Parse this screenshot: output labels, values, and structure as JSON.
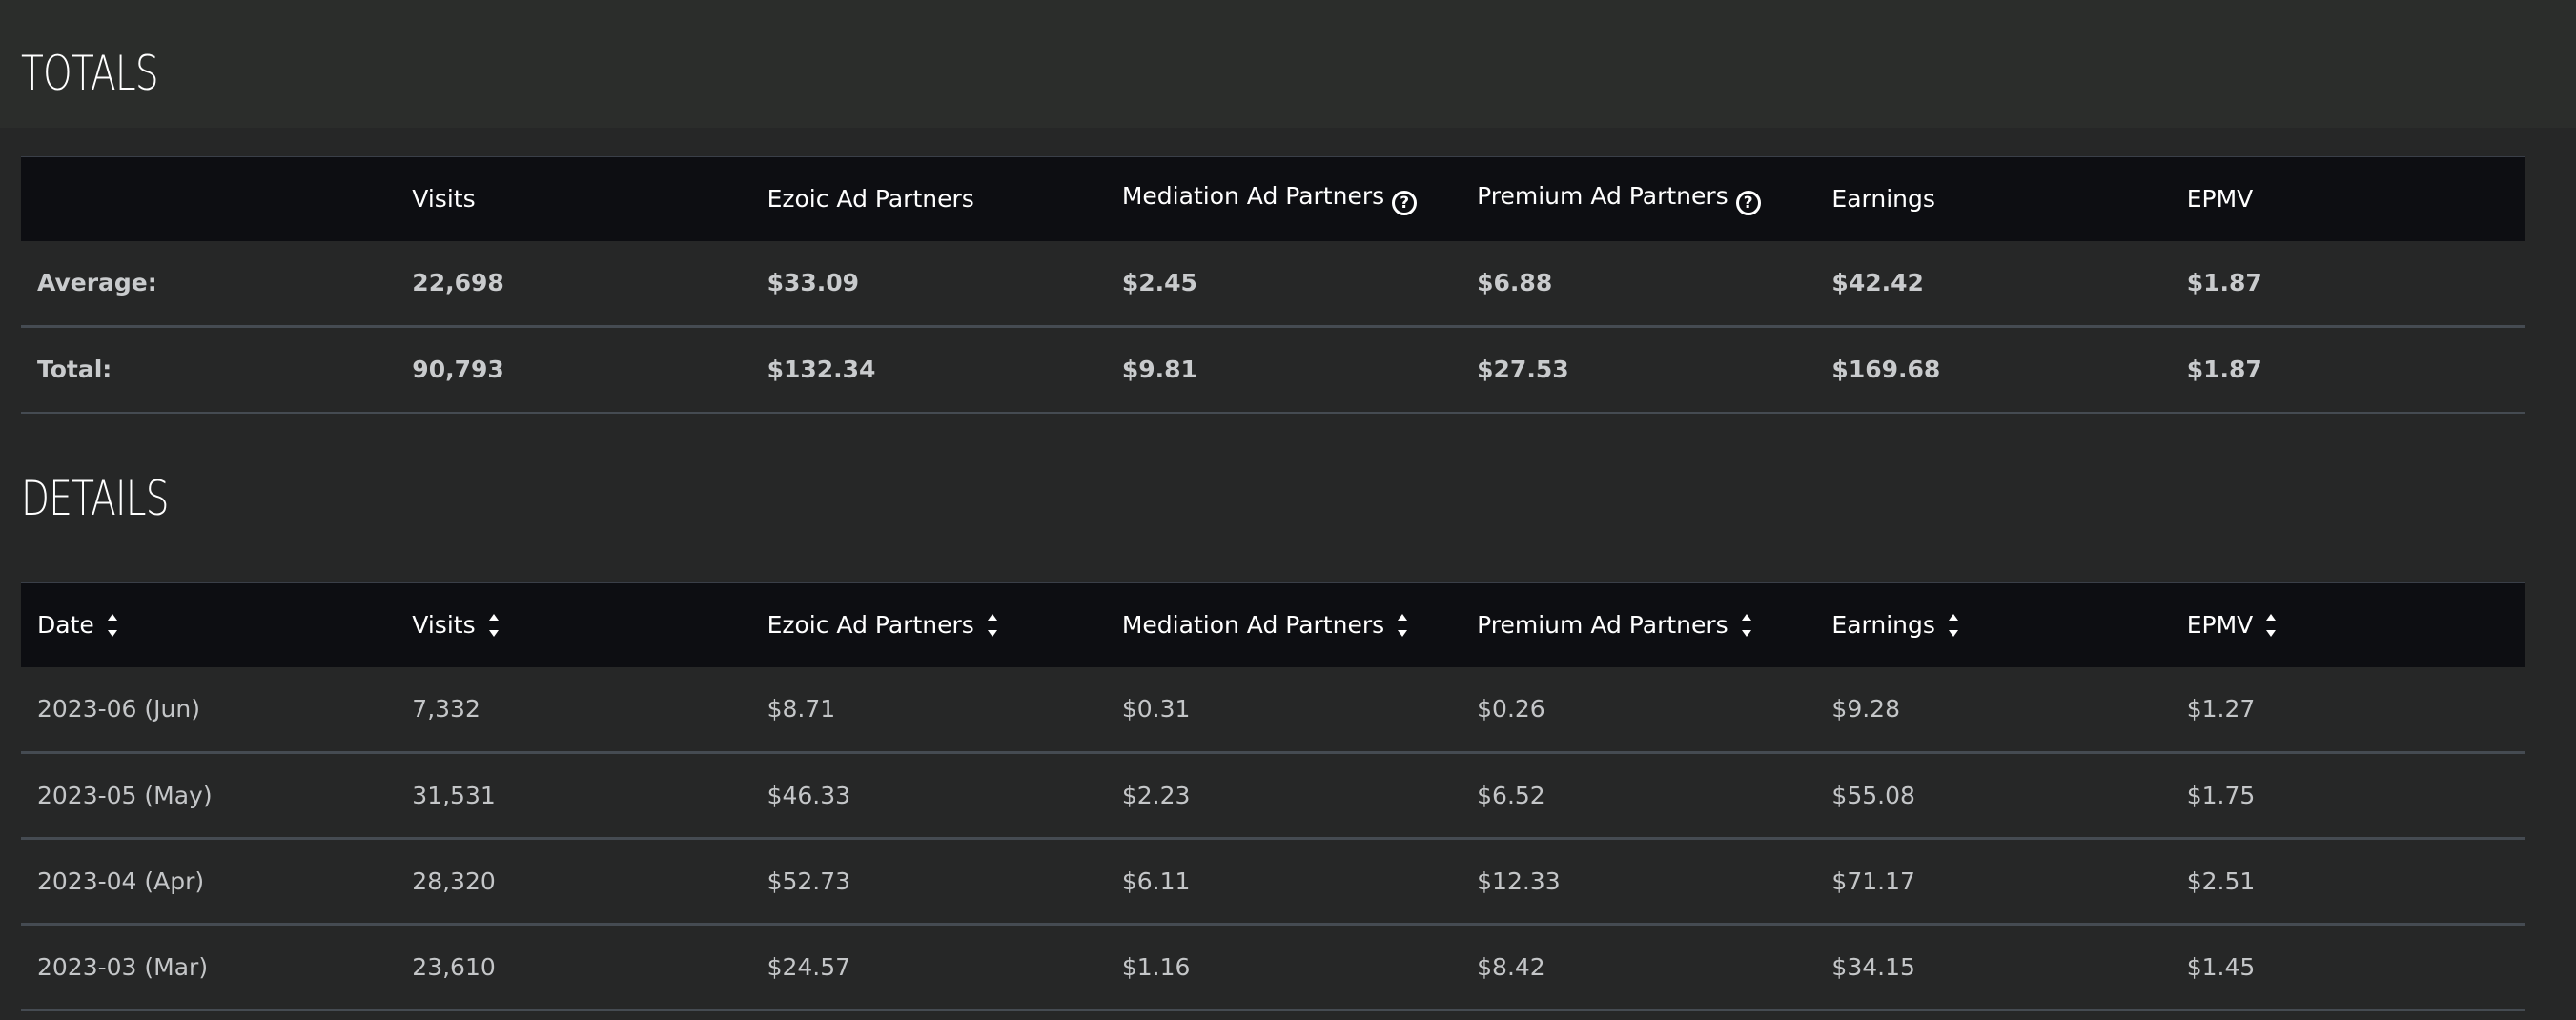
{
  "totals": {
    "title": "TOTALS",
    "columns": [
      "",
      "Visits",
      "Ezoic Ad Partners",
      "Mediation Ad Partners",
      "Premium Ad Partners",
      "Earnings",
      "EPMV"
    ],
    "rows": [
      [
        "Average:",
        "22,698",
        "$33.09",
        "$2.45",
        "$6.88",
        "$42.42",
        "$1.87"
      ],
      [
        "Total:",
        "90,793",
        "$132.34",
        "$9.81",
        "$27.53",
        "$169.68",
        "$1.87"
      ]
    ]
  },
  "details": {
    "title": "DETAILS",
    "columns": [
      "Date",
      "Visits",
      "Ezoic Ad Partners",
      "Mediation Ad Partners",
      "Premium Ad Partners",
      "Earnings",
      "EPMV"
    ],
    "rows": [
      [
        "2023-06 (Jun)",
        "7,332",
        "$8.71",
        "$0.31",
        "$0.26",
        "$9.28",
        "$1.27"
      ],
      [
        "2023-05 (May)",
        "31,531",
        "$46.33",
        "$2.23",
        "$6.52",
        "$55.08",
        "$1.75"
      ],
      [
        "2023-04 (Apr)",
        "28,320",
        "$52.73",
        "$6.11",
        "$12.33",
        "$71.17",
        "$2.51"
      ],
      [
        "2023-03 (Mar)",
        "23,610",
        "$24.57",
        "$1.16",
        "$8.42",
        "$34.15",
        "$1.45"
      ]
    ]
  },
  "icons": {
    "help": "?",
    "help_icon_name": "question-circle-icon",
    "sort_icon_name": "sort-arrows-icon"
  },
  "colors": {
    "page_bg": "#262727",
    "header_bg": "#0d0e12",
    "divider": "#454b52",
    "title": "#ffffff"
  }
}
